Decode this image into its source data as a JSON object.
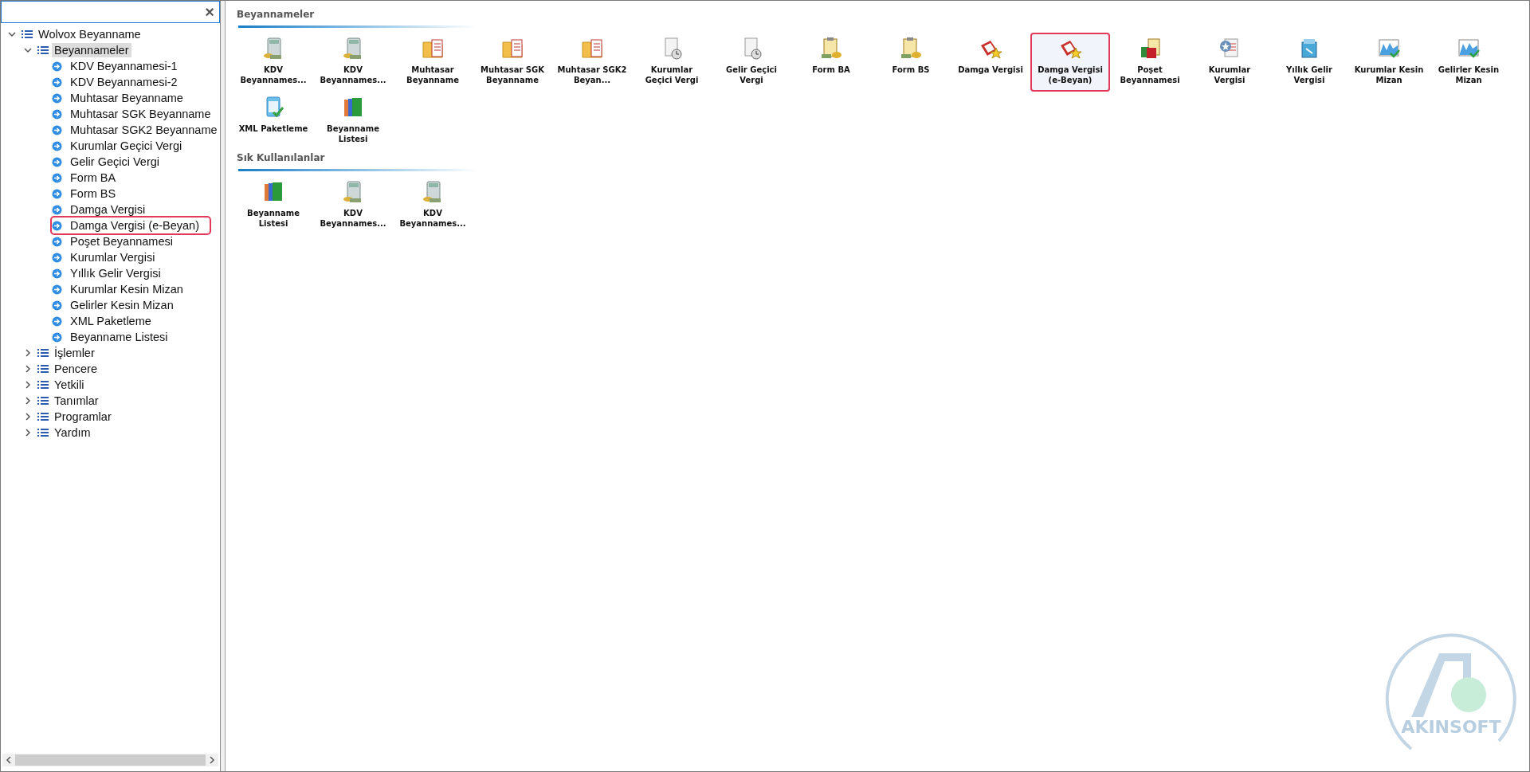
{
  "search": {
    "clear": "×"
  },
  "tree": {
    "label": "Wolvox Beyanname",
    "expanded": true,
    "children": [
      {
        "label": "Beyannameler",
        "expanded": true,
        "selected": true,
        "children": [
          {
            "label": "KDV Beyannamesi-1",
            "highlighted": false
          },
          {
            "label": "KDV Beyannamesi-2",
            "highlighted": false
          },
          {
            "label": "Muhtasar Beyanname",
            "highlighted": false
          },
          {
            "label": "Muhtasar SGK  Beyanname",
            "highlighted": false
          },
          {
            "label": "Muhtasar SGK2  Beyanname",
            "highlighted": false
          },
          {
            "label": "Kurumlar Geçici Vergi",
            "highlighted": false
          },
          {
            "label": "Gelir Geçici Vergi",
            "highlighted": false
          },
          {
            "label": "Form BA",
            "highlighted": false
          },
          {
            "label": "Form BS",
            "highlighted": false
          },
          {
            "label": "Damga Vergisi",
            "highlighted": false
          },
          {
            "label": "Damga Vergisi (e-Beyan)",
            "highlighted": true
          },
          {
            "label": "Poşet Beyannamesi",
            "highlighted": false
          },
          {
            "label": "Kurumlar Vergisi",
            "highlighted": false
          },
          {
            "label": "Yıllık Gelir Vergisi",
            "highlighted": false
          },
          {
            "label": "Kurumlar Kesin Mizan",
            "highlighted": false
          },
          {
            "label": "Gelirler Kesin Mizan",
            "highlighted": false
          },
          {
            "label": "XML Paketleme",
            "highlighted": false
          },
          {
            "label": "Beyanname Listesi",
            "highlighted": false
          }
        ]
      },
      {
        "label": "İşlemler",
        "expanded": false,
        "selected": false
      },
      {
        "label": "Pencere",
        "expanded": false,
        "selected": false
      },
      {
        "label": "Yetkili",
        "expanded": false,
        "selected": false
      },
      {
        "label": "Tanımlar",
        "expanded": false,
        "selected": false
      },
      {
        "label": "Programlar",
        "expanded": false,
        "selected": false
      },
      {
        "label": "Yardım",
        "expanded": false,
        "selected": false
      }
    ]
  },
  "sections": [
    {
      "title": "Beyannameler",
      "tiles": [
        {
          "label": "KDV Beyannames...",
          "kind": "calculator",
          "highlighted": false
        },
        {
          "label": "KDV Beyannames...",
          "kind": "calculator",
          "highlighted": false
        },
        {
          "label": "Muhtasar Beyanname",
          "kind": "folder",
          "highlighted": false
        },
        {
          "label": "Muhtasar SGK Beyanname",
          "kind": "folder",
          "highlighted": false
        },
        {
          "label": "Muhtasar SGK2  Beyan...",
          "kind": "folder",
          "highlighted": false
        },
        {
          "label": "Kurumlar Geçici Vergi",
          "kind": "clockdoc",
          "highlighted": false
        },
        {
          "label": "Gelir Geçici Vergi",
          "kind": "clockdoc",
          "highlighted": false
        },
        {
          "label": "Form BA",
          "kind": "clipboard",
          "highlighted": false
        },
        {
          "label": "Form BS",
          "kind": "clipboard",
          "highlighted": false
        },
        {
          "label": "Damga Vergisi",
          "kind": "stamp",
          "highlighted": false
        },
        {
          "label": "Damga Vergisi (e-Beyan)",
          "kind": "stamp",
          "highlighted": true
        },
        {
          "label": "Poşet Beyannamesi",
          "kind": "bag",
          "highlighted": false
        },
        {
          "label": "Kurumlar Vergisi",
          "kind": "docstar",
          "highlighted": false
        },
        {
          "label": "Yıllık Gelir Vergisi",
          "kind": "box",
          "highlighted": false
        },
        {
          "label": "Kurumlar Kesin Mizan",
          "kind": "chart",
          "highlighted": false
        },
        {
          "label": "Gelirler Kesin Mizan",
          "kind": "chart",
          "highlighted": false
        },
        {
          "label": "XML Paketleme",
          "kind": "xml",
          "highlighted": false
        },
        {
          "label": "Beyanname Listesi",
          "kind": "books",
          "highlighted": false
        }
      ]
    },
    {
      "title": "Sık Kullanılanlar",
      "tiles": [
        {
          "label": "Beyanname Listesi",
          "kind": "books",
          "highlighted": false
        },
        {
          "label": "KDV Beyannames...",
          "kind": "calculator",
          "highlighted": false
        },
        {
          "label": "KDV Beyannames...",
          "kind": "calculator",
          "highlighted": false
        }
      ]
    }
  ],
  "logo": {
    "text": "AKINSOFT"
  }
}
